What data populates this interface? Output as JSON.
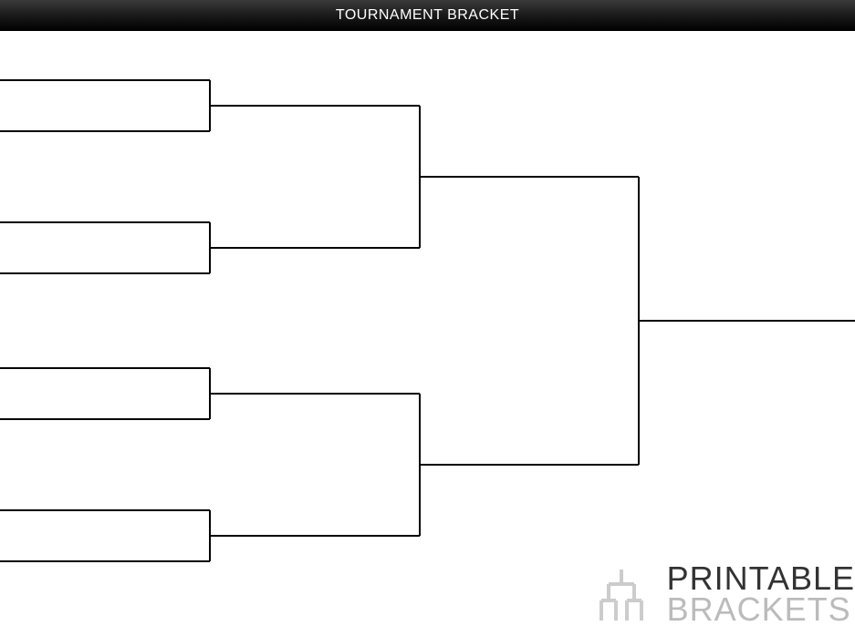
{
  "header": {
    "title": "TOURNAMENT BRACKET"
  },
  "watermark": {
    "line1": "PRINTABLE",
    "line2": "BRACKETS"
  },
  "bracket": {
    "rounds": 4,
    "slots": {
      "r1": [
        "",
        "",
        "",
        ""
      ],
      "r2": [
        "",
        ""
      ],
      "r3": [
        ""
      ],
      "r4": [
        ""
      ]
    }
  }
}
